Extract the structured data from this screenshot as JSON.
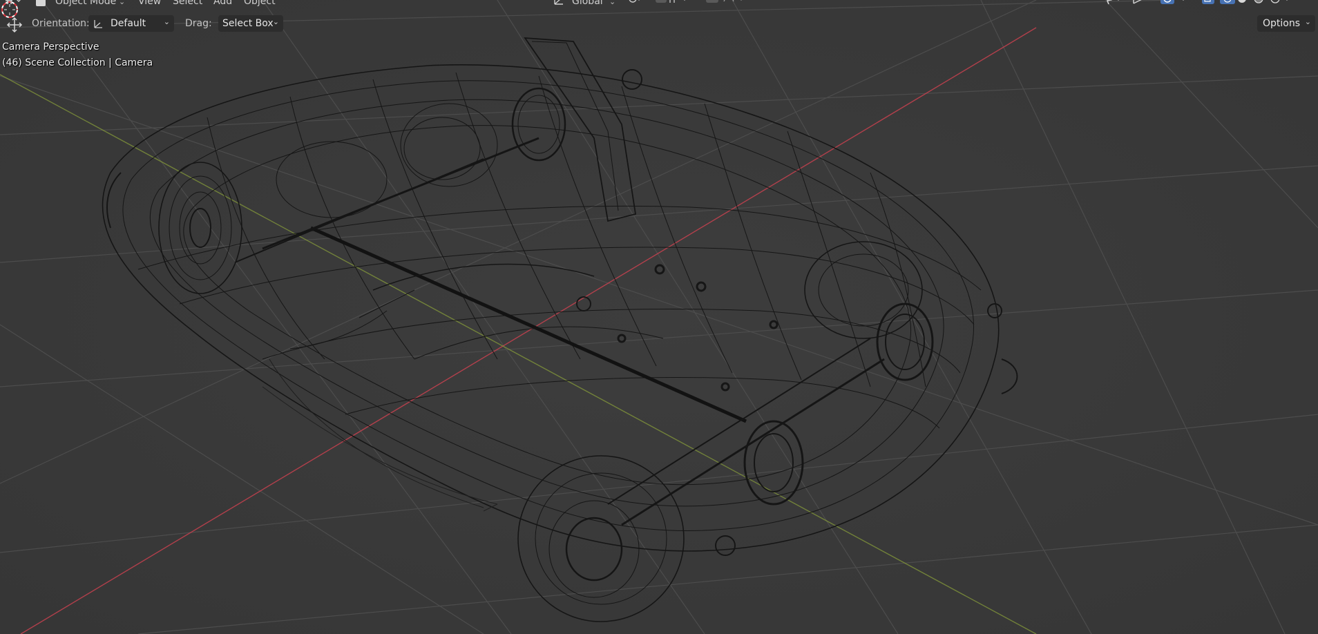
{
  "header": {
    "mode_label": "Object Mode",
    "menus": [
      "View",
      "Select",
      "Add",
      "Object"
    ],
    "transform_space": "Global"
  },
  "tool_settings": {
    "orientation_label": "Orientation:",
    "orientation_value": "Default",
    "drag_label": "Drag:",
    "drag_value": "Select Box",
    "options_label": "Options"
  },
  "viewport": {
    "view_name": "Camera Perspective",
    "collection_info": "(46) Scene Collection | Camera",
    "shading": "wireframe",
    "x_axis_color": "#c8414f",
    "y_axis_color": "#8aa03a",
    "background_color": "#393939",
    "grid_color": "#4a4a4a",
    "wire_color": "#151515"
  },
  "icons": {
    "tool": "move-tool-icon",
    "cursor": "3d-cursor-icon"
  }
}
